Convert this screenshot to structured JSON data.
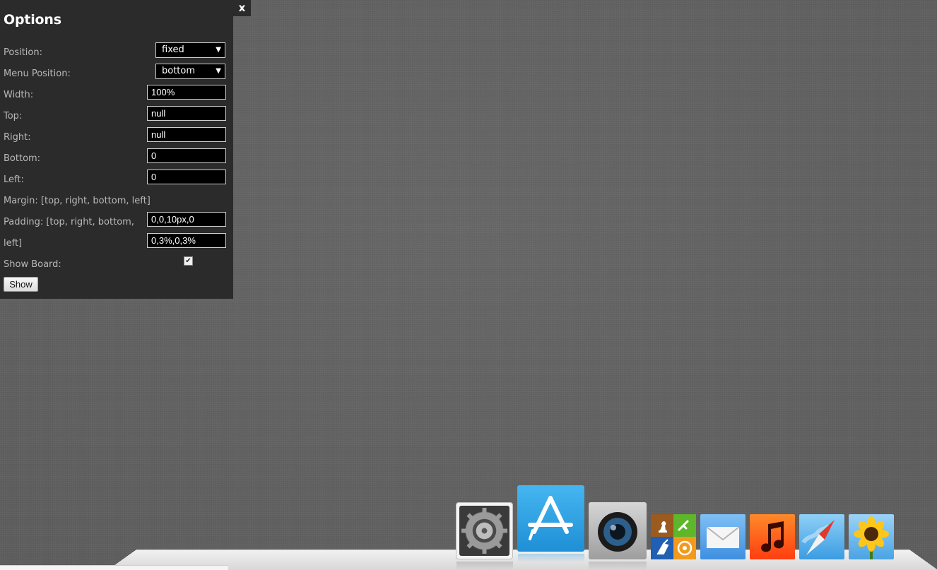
{
  "options_panel": {
    "title": "Options",
    "close_label": "x",
    "position": {
      "label": "Position:",
      "value": "fixed"
    },
    "menu_position": {
      "label": "Menu Position:",
      "value": "bottom"
    },
    "width": {
      "label": "Width:",
      "value": "100%"
    },
    "top": {
      "label": "Top:",
      "value": "null"
    },
    "right": {
      "label": "Right:",
      "value": "null"
    },
    "bottom": {
      "label": "Bottom:",
      "value": "0"
    },
    "left": {
      "label": "Left:",
      "value": "0"
    },
    "margin": {
      "label": "Margin: [top, right, bottom, left]",
      "value": "0,0,10px,0"
    },
    "padding": {
      "label_line1": "Padding: [top, right, bottom,",
      "label_line2": "left]",
      "value": "0,3%,0,3%"
    },
    "show_board": {
      "label": "Show Board:",
      "checked": true
    },
    "show_button_label": "Show"
  },
  "dock": {
    "icons": [
      {
        "name": "system-preferences-icon"
      },
      {
        "name": "app-store-icon"
      },
      {
        "name": "camera-icon"
      },
      {
        "name": "games-icon"
      },
      {
        "name": "mail-icon"
      },
      {
        "name": "music-icon"
      },
      {
        "name": "safari-icon"
      },
      {
        "name": "sunflower-icon"
      }
    ]
  },
  "colors": {
    "panel_bg": "#2b2b2b",
    "desktop_bg": "#5f5f5f",
    "app_store_blue": "#2f9fe0",
    "music_orange": "#ff5a1a"
  }
}
